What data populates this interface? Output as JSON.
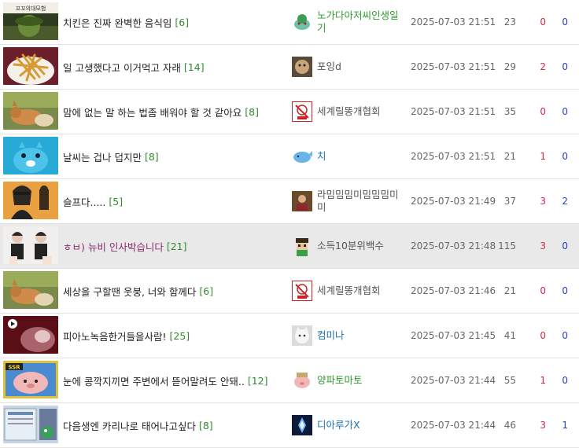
{
  "posts": [
    {
      "title": "치킨은 진짜 완벽한 음식임",
      "comments": "[6]",
      "author": "노가다아저씨인생일기",
      "date": "2025-07-03 21:51",
      "views": "23",
      "up": "0",
      "down": "0",
      "thumb_label": "꼬꼬의대모험"
    },
    {
      "title": "일 고생했다고 이거먹고 자래",
      "comments": "[14]",
      "author": "포잉d",
      "date": "2025-07-03 21:51",
      "views": "29",
      "up": "2",
      "down": "0"
    },
    {
      "title": "맘에 없는 말 하는 법좀 배워야 할 것 같아요",
      "comments": "[8]",
      "author": "세계릴똥개협회",
      "date": "2025-07-03 21:51",
      "views": "35",
      "up": "0",
      "down": "0"
    },
    {
      "title": "날씨는 겁나 덥지만",
      "comments": "[8]",
      "author": "치",
      "date": "2025-07-03 21:51",
      "views": "21",
      "up": "1",
      "down": "0"
    },
    {
      "title": "슬프다.....",
      "comments": "[5]",
      "author": "라밈밈밈미밈밈밈미미",
      "date": "2025-07-03 21:49",
      "views": "37",
      "up": "3",
      "down": "2"
    },
    {
      "title": "ㅎㅂ) 뉴비 인사박습니다",
      "comments": "[21]",
      "author": "소득10분위백수",
      "date": "2025-07-03 21:48",
      "views": "115",
      "up": "3",
      "down": "0"
    },
    {
      "title": "세상을 구할땐 웃붕, 너와 함께다",
      "comments": "[6]",
      "author": "세계릴똥개협회",
      "date": "2025-07-03 21:46",
      "views": "21",
      "up": "0",
      "down": "0"
    },
    {
      "title": "피아노녹음한거들을사람!",
      "comments": "[25]",
      "author": "컴미나",
      "date": "2025-07-03 21:45",
      "views": "41",
      "up": "0",
      "down": "0"
    },
    {
      "title": "눈에 콩깍지끼면 주변에서 뜯어말려도 안돼..",
      "comments": "[12]",
      "author": "양파토마토",
      "date": "2025-07-03 21:44",
      "views": "55",
      "up": "1",
      "down": "0",
      "thumb_label": "SSR"
    },
    {
      "title": "다음생엔 카리나로 태어나고싶다",
      "comments": "[8]",
      "author": "디아루가X",
      "date": "2025-07-03 21:44",
      "views": "46",
      "up": "3",
      "down": "1"
    }
  ],
  "colors": {
    "comment": "#2e8b2e",
    "upvote": "#d8264a",
    "downvote": "#2a3fc7",
    "highlight_row": "#e9e9e9",
    "highlight_title": "#8a2b6b"
  },
  "icons": [
    "pokemon-avatar-icon",
    "hamster-avatar-icon",
    "dog-stamp-icon",
    "whale-icon",
    "person-avatar-icon",
    "pixel-avatar-icon",
    "dog-stamp-icon",
    "cat-avatar-icon",
    "pig-avatar-icon",
    "dialga-icon"
  ]
}
